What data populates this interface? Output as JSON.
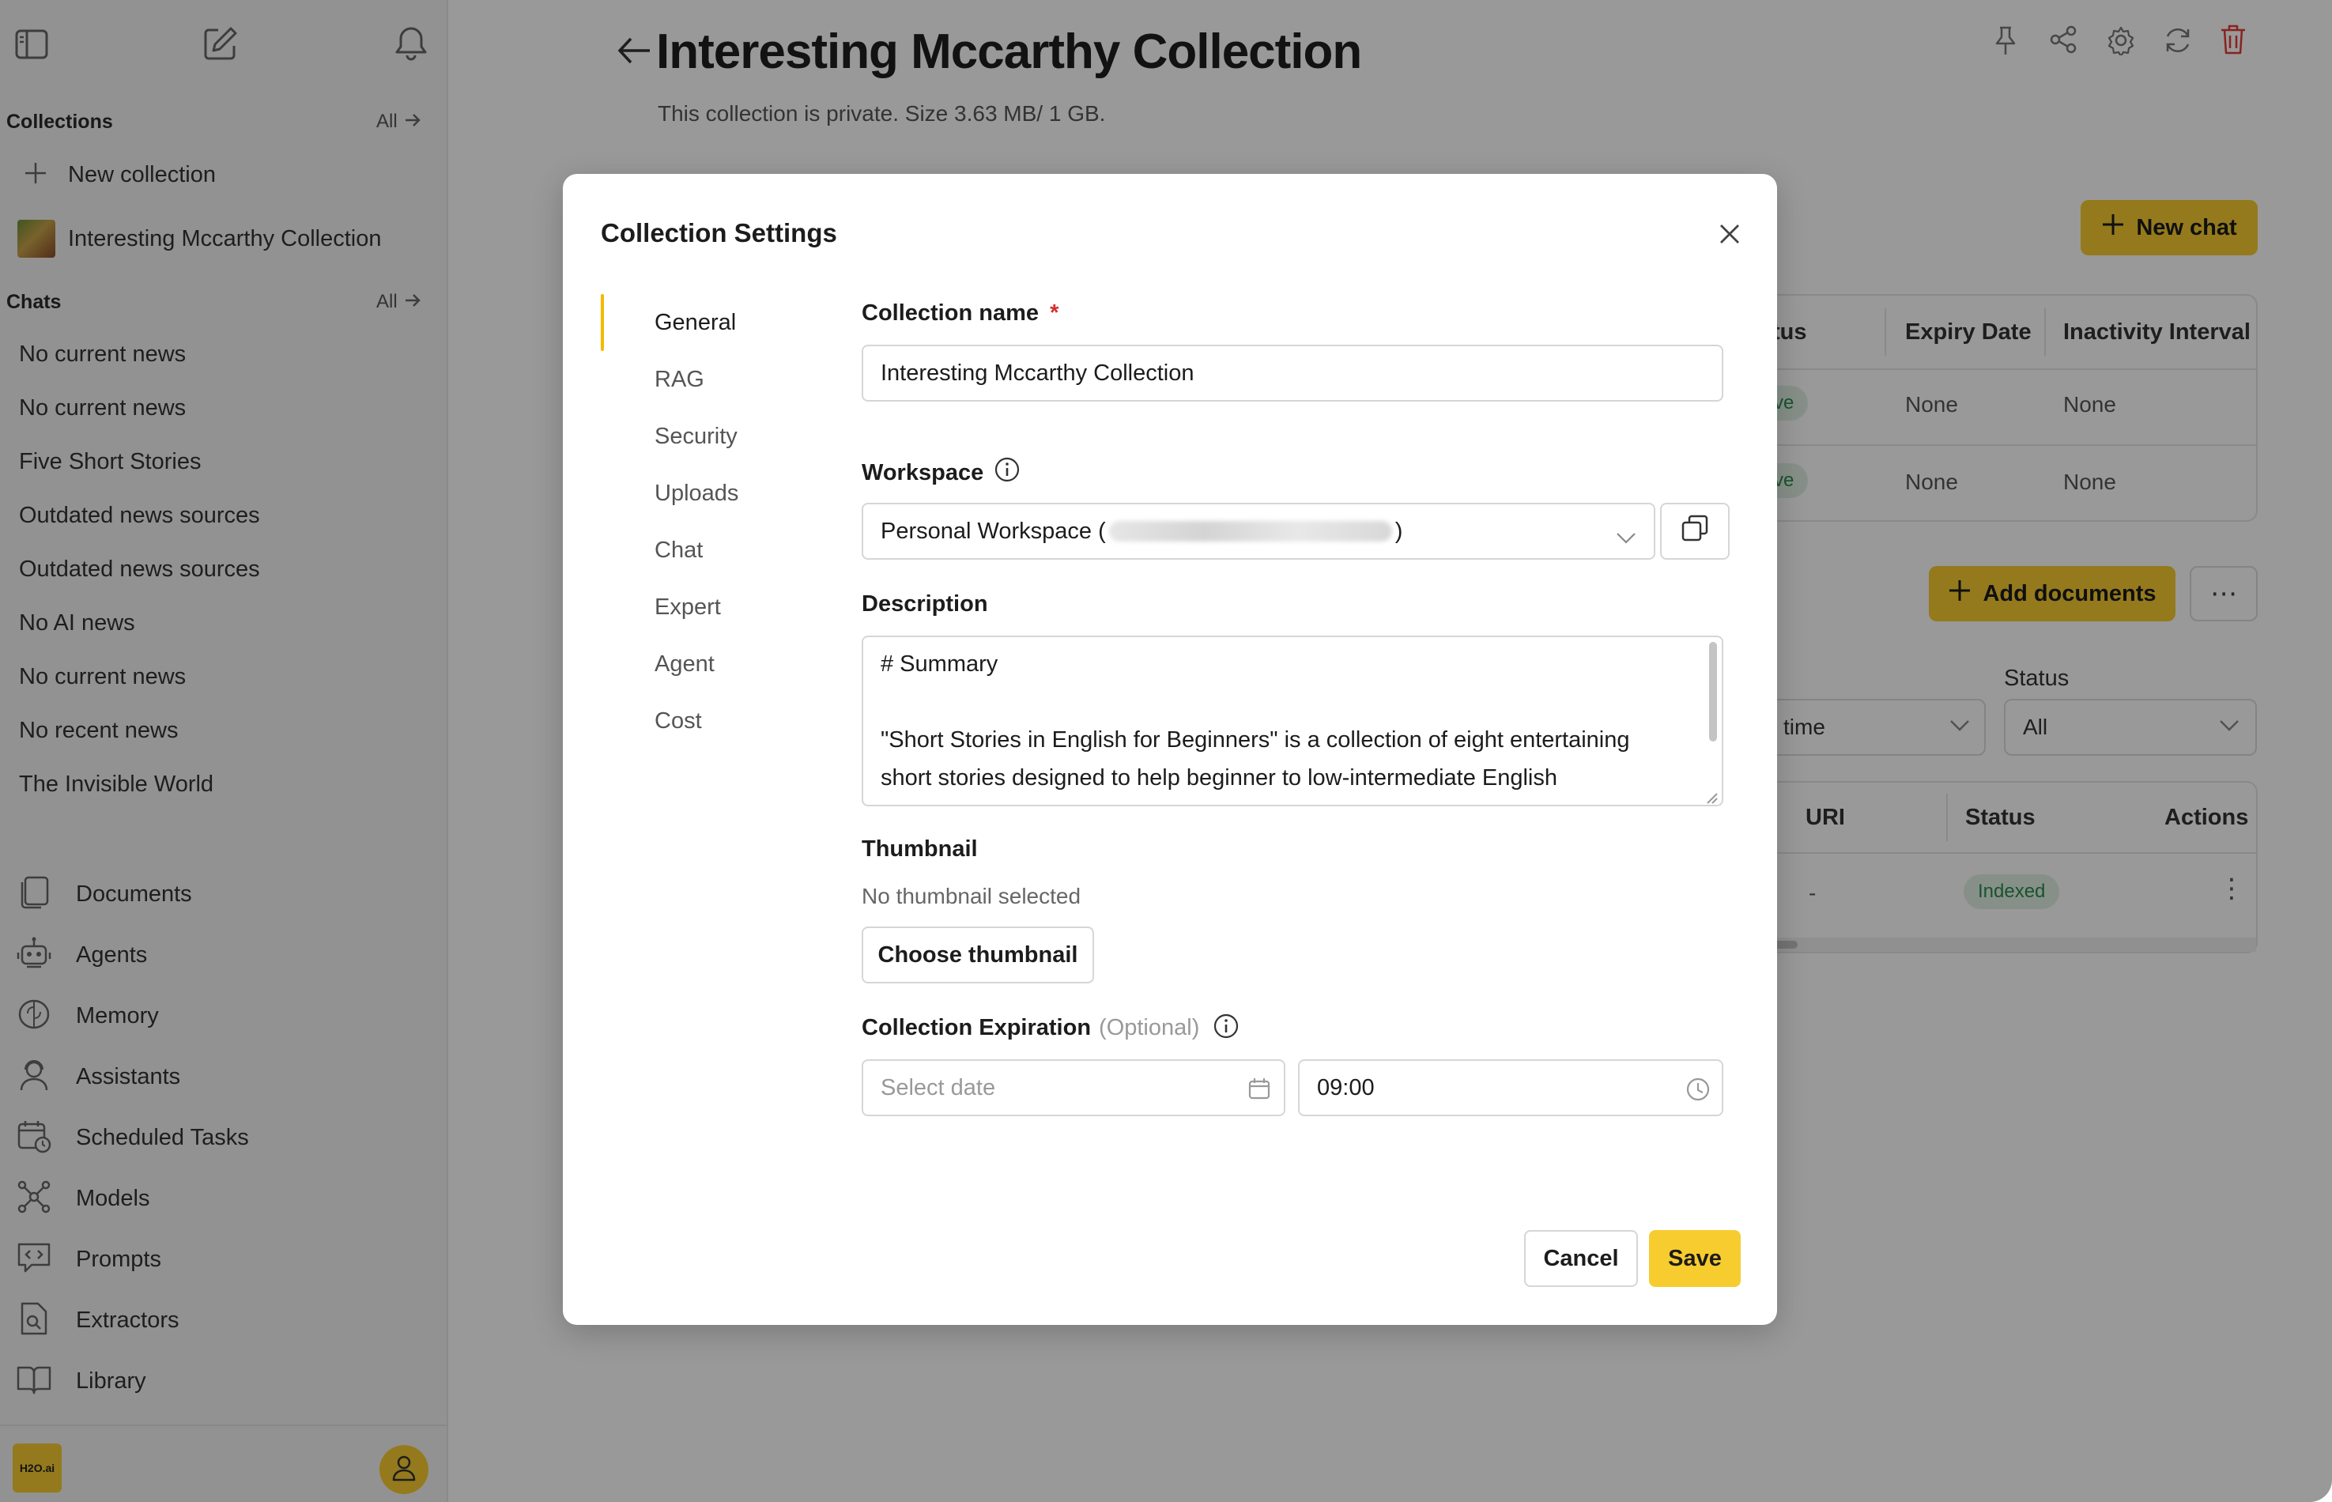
{
  "colors": {
    "accent": "#f7cc2f",
    "danger": "#e53935",
    "active_green": "#2b8a4b",
    "menu_indicator": "#f5b800"
  },
  "sidebar": {
    "collections_label": "Collections",
    "collections_all": "All",
    "new_collection": "New collection",
    "current_collection": "Interesting Mccarthy Collection",
    "chats_label": "Chats",
    "chats_all": "All",
    "chats": [
      "No current news",
      "No current news",
      "Five Short Stories",
      "Outdated news sources",
      "Outdated news sources",
      "No AI news",
      "No current news",
      "No recent news",
      "The Invisible World"
    ],
    "nav": [
      {
        "label": "Documents",
        "icon": "documents-icon"
      },
      {
        "label": "Agents",
        "icon": "robot-icon"
      },
      {
        "label": "Memory",
        "icon": "brain-icon"
      },
      {
        "label": "Assistants",
        "icon": "assistant-icon"
      },
      {
        "label": "Scheduled Tasks",
        "icon": "calendar-clock-icon"
      },
      {
        "label": "Models",
        "icon": "network-icon"
      },
      {
        "label": "Prompts",
        "icon": "code-chat-icon"
      },
      {
        "label": "Extractors",
        "icon": "file-search-icon"
      },
      {
        "label": "Library",
        "icon": "book-icon"
      }
    ],
    "logo_text": "H2O.ai"
  },
  "header": {
    "title": "Interesting Mccarthy Collection",
    "subtitle": "This collection is private. Size 3.63 MB/ 1 GB."
  },
  "main": {
    "new_chat": "New chat",
    "sessions_table": {
      "headers": [
        "tus",
        "Expiry Date",
        "Inactivity Interval"
      ],
      "rows": [
        [
          "ctive",
          "None",
          "None"
        ],
        [
          "ctive",
          "None",
          "None"
        ]
      ]
    },
    "add_documents": "Add documents",
    "more": "⋯",
    "filter_time": "time",
    "status_label": "Status",
    "status_value": "All",
    "docs_table": {
      "headers": [
        "URI",
        "Status",
        "Actions"
      ],
      "row": {
        "uri": "-",
        "status": "Indexed",
        "actions": "⋮"
      }
    }
  },
  "modal": {
    "title": "Collection Settings",
    "menu": [
      "General",
      "RAG",
      "Security",
      "Uploads",
      "Chat",
      "Expert",
      "Agent",
      "Cost"
    ],
    "active_menu": "General",
    "collection_name_label": "Collection name",
    "required_mark": "*",
    "collection_name_value": "Interesting Mccarthy Collection",
    "workspace_label": "Workspace",
    "workspace_prefix": "Personal Workspace (",
    "workspace_suffix": ")",
    "description_label": "Description",
    "description_line1": "# Summary",
    "description_line2": "\"Short Stories in English for Beginners\" is a collection of eight entertaining",
    "description_line3": "short stories designed to help beginner to low-intermediate English",
    "thumbnail_label": "Thumbnail",
    "thumbnail_status": "No thumbnail selected",
    "choose_thumbnail": "Choose thumbnail",
    "expiration_label": "Collection Expiration",
    "expiration_optional": "(Optional)",
    "date_placeholder": "Select date",
    "time_value": "09:00",
    "cancel": "Cancel",
    "save": "Save"
  }
}
